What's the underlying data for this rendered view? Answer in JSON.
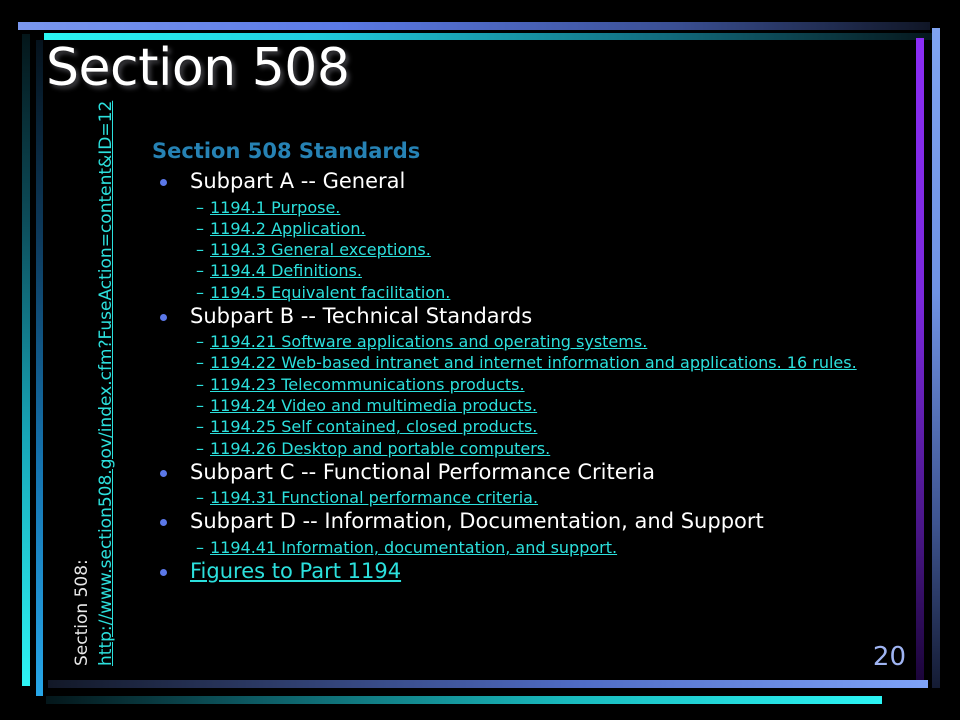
{
  "slide": {
    "title": "Section 508",
    "page_number": "20",
    "background_color": "#000000"
  },
  "side_label": {
    "caption": "Section 508:",
    "url": "http://www.section508.gov/index.cfm?FuseAction=content&ID=12"
  },
  "content": {
    "heading": "Section 508 Standards",
    "items": [
      {
        "label": "Subpart A -- General",
        "is_link": false,
        "sub_items": [
          "1194.1 Purpose.",
          "1194.2 Application.",
          "1194.3 General exceptions.",
          "1194.4 Definitions.",
          "1194.5 Equivalent facilitation."
        ]
      },
      {
        "label": "Subpart B -- Technical Standards",
        "is_link": false,
        "sub_items": [
          "1194.21 Software applications and operating systems.",
          "1194.22 Web-based intranet and internet information and applications. 16 rules.",
          "1194.23 Telecommunications products.",
          "1194.24 Video and multimedia products.",
          "1194.25 Self contained, closed products.",
          "1194.26 Desktop and portable computers."
        ]
      },
      {
        "label": "Subpart C -- Functional Performance Criteria",
        "is_link": false,
        "sub_items": [
          "1194.31 Functional performance criteria."
        ]
      },
      {
        "label": "Subpart D -- Information, Documentation, and Support",
        "is_link": false,
        "sub_items": [
          "1194.41 Information, documentation, and support."
        ]
      },
      {
        "label": "Figures to Part 1194",
        "is_link": true,
        "sub_items": []
      }
    ]
  },
  "theme": {
    "accent_cyan": "#2ce0dd",
    "accent_blue": "#5b78e8",
    "accent_violet": "#8b2df5",
    "heading_blue": "#2682b4",
    "page_number_color": "#9fb4f2",
    "title_color": "#ffffff"
  }
}
